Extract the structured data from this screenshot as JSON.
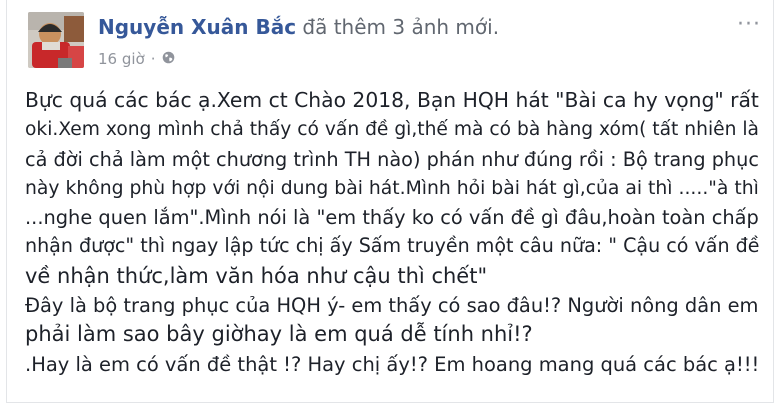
{
  "post": {
    "author": "Nguyễn Xuân Bắc",
    "action": "đã thêm 3 ảnh mới.",
    "time": "16 giờ",
    "separator": "·",
    "privacy_icon": "globe-icon",
    "menu_icon": "more-options-icon",
    "menu_glyph": "···",
    "lines": [
      "Bực quá các bác ạ.Xem ct Chào 2018, Bạn HQH hát \"Bài ca hy vọng\" rất",
      "oki.Xem xong mình chả thấy có vấn đề gì,thế mà có bà hàng xóm( tất nhiên là",
      "cả đời chả làm một chương trình TH nào) phán như đúng rồi : Bộ trang phục",
      "này không phù hợp với nội dung bài hát.Mình hỏi bài hát gì,của ai thì .....\"à thì",
      "...nghe quen lắm\".Mình nói là \"em thấy ko có vấn đề gì đâu,hoàn toàn chấp",
      "nhận được\" thì ngay lập tức chị ấy Sấm truyền một câu nữa: \" Cậu có vấn đề",
      "về nhận thức,làm văn hóa như cậu thì chết\"",
      "Đây là bộ trang phục của HQH ý- em thấy có sao đâu!? Người nông dân em",
      "phải làm sao bây giờhay là em quá dễ tính nhỉ!?",
      ".Hay là em có vấn đề thật !? Hay chị ấy!? Em hoang mang quá các bác ạ!!!"
    ]
  },
  "colors": {
    "author_link": "#365899",
    "meta_text": "#90949c",
    "body_text": "#1d2129"
  }
}
